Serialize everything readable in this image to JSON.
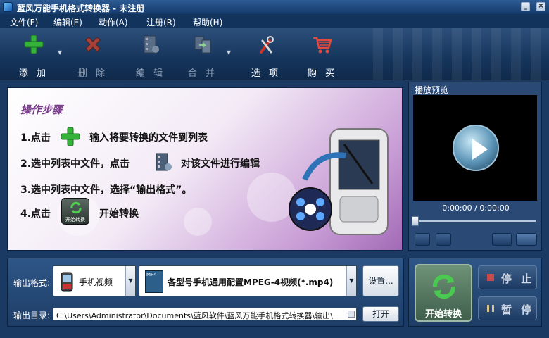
{
  "window": {
    "title": "藍风万能手机格式转换器 - 未注册"
  },
  "menu": [
    "文件(F)",
    "编辑(E)",
    "动作(A)",
    "注册(R)",
    "帮助(H)"
  ],
  "toolbar": {
    "add": "添 加",
    "delete": "删 除",
    "edit": "编 辑",
    "merge": "合 并",
    "options": "选 项",
    "buy": "购 买"
  },
  "guide": {
    "heading": "操作步骤",
    "step1_a": "1.点击",
    "step1_b": "输入将要转换的文件到列表",
    "step2_a": "2.选中列表中文件，点击",
    "step2_b": "对该文件进行编辑",
    "step3": "3.选中列表中文件，选择“输出格式”。",
    "step4_a": "4.点击",
    "step4_b": "开始转换",
    "step4_icon_label": "开始转换"
  },
  "preview": {
    "title": "播放预览",
    "time": "0:00:00 / 0:00:00"
  },
  "output": {
    "format_label": "输出格式:",
    "category": "手机视频",
    "profile_badge": "MP4",
    "profile": "各型号手机通用配置MPEG-4视频(*.mp4)",
    "settings_button": "设置...",
    "dir_label": "输出目录:",
    "dir_path": "C:\\Users\\Administrator\\Documents\\蓝风软件\\蓝风万能手机格式转换器\\输出\\",
    "open_button": "打开"
  },
  "convert": {
    "start": "开始转换",
    "stop": "停 止",
    "pause": "暂 停"
  },
  "colors": {
    "accent_green": "#2fa12f",
    "delete_red": "#c0392b",
    "guide_purple": "#7a3b8c"
  }
}
